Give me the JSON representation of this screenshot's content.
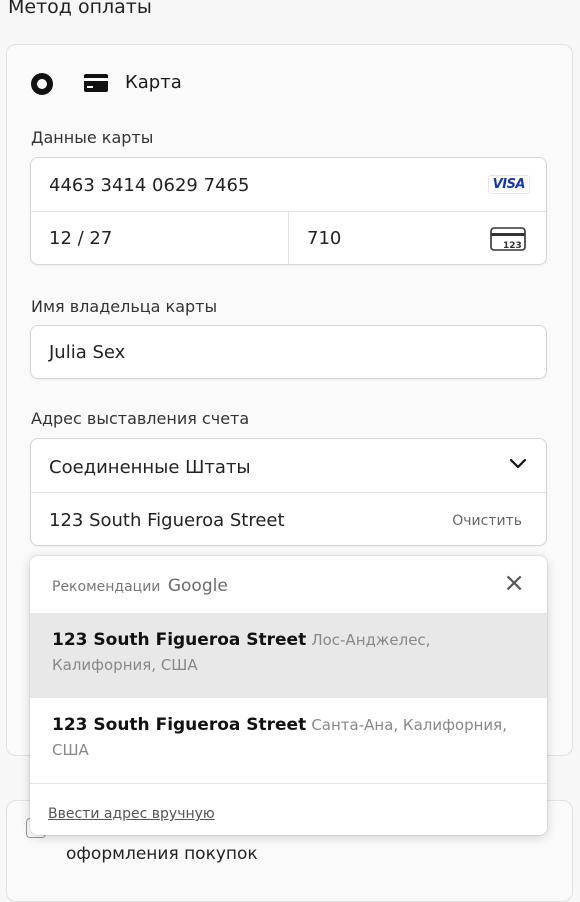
{
  "page_title": "Метод оплаты",
  "payment_method": {
    "label": "Карта",
    "selected": true
  },
  "card_details": {
    "section_label": "Данные карты",
    "number": "4463 3414 0629 7465",
    "brand": "VISA",
    "expiry": "12 / 27",
    "cvc": "710",
    "cvc_icon_text": "123"
  },
  "cardholder": {
    "section_label": "Имя владельца карты",
    "name": "Julia Sex"
  },
  "billing": {
    "section_label": "Адрес выставления счета",
    "country": "Соединенные Штаты",
    "address_line": "123 South Figueroa Street",
    "clear_label": "Очистить"
  },
  "suggestions": {
    "header": "Рекомендации",
    "provider": "Google",
    "items": [
      {
        "street": "123 South Figueroa Street",
        "rest_1": "Лос-Анджелес,",
        "rest_2": "Калифорния, США",
        "highlighted": true
      },
      {
        "street": "123 South Figueroa Street",
        "rest_1": "Санта-Ана, Калифорния,",
        "rest_2": "США",
        "highlighted": false
      }
    ],
    "manual_entry": "Ввести адрес вручную"
  },
  "save_info": {
    "text": "оформления покупок"
  },
  "colors": {
    "accent": "#111111",
    "visa_blue": "#1a3aa0",
    "highlight": "#e8e8e8"
  }
}
